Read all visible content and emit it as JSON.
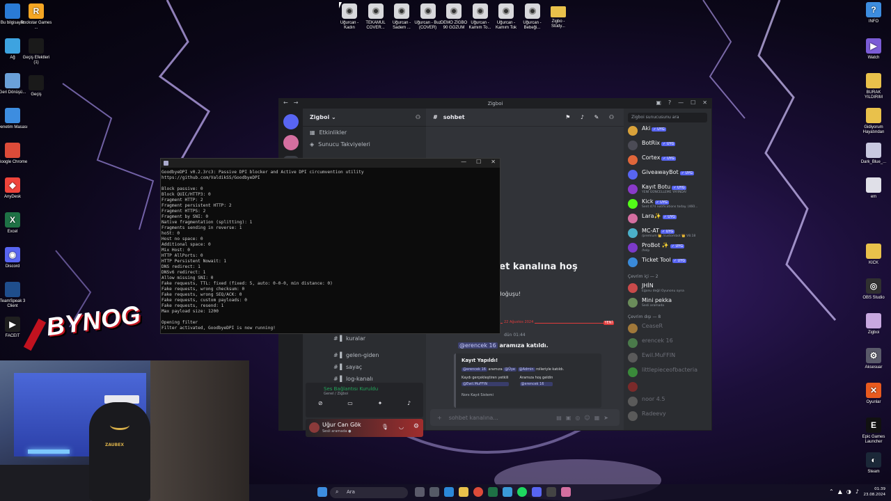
{
  "desktop_left": [
    {
      "label": "Bu bilgisayar",
      "color": "#2a7bd6",
      "glyph": ""
    },
    {
      "label": "Rockstar Games ...",
      "color": "#f5a623",
      "glyph": "R"
    },
    {
      "label": "Ağ",
      "color": "#3da3e0",
      "glyph": ""
    },
    {
      "label": "Geçiş Efektleri (1)",
      "color": "#1a1a1a",
      "glyph": ""
    },
    {
      "label": "Geri Dönüşü...",
      "color": "#6aa0d8",
      "glyph": ""
    },
    {
      "label": "Geçiş",
      "color": "#1a1a1a",
      "glyph": ""
    },
    {
      "label": "Denetim Masası",
      "color": "#3d8de0",
      "glyph": ""
    },
    {
      "label": "Google Chrome",
      "color": "#dd4b39",
      "glyph": ""
    },
    {
      "label": "AnyDesk",
      "color": "#ef443b",
      "glyph": "◆"
    },
    {
      "label": "Excel",
      "color": "#1e7145",
      "glyph": "X"
    },
    {
      "label": "Discord",
      "color": "#5865f2",
      "glyph": "◉"
    },
    {
      "label": "TeamSpeak 3 Client",
      "color": "#1f4e8c",
      "glyph": ""
    },
    {
      "label": "FACEIT",
      "color": "#1f1f1f",
      "glyph": "▶"
    }
  ],
  "desktop_top": [
    {
      "label": "Uğurcan - Kadın"
    },
    {
      "label": "TEKAMUL COVER..."
    },
    {
      "label": "Uğurcan - Sadem ..."
    },
    {
      "label": "Uğurcan - Buz (COVER)"
    },
    {
      "label": "DEMO ZİGBO 90 GOZUM"
    },
    {
      "label": "Uğurcan - Kamım To..."
    },
    {
      "label": "Uğurcan - Kamım Tok"
    },
    {
      "label": "Uğurcan - Bebeği..."
    },
    {
      "label": "Zigbo - Stüdy...",
      "folder": true
    }
  ],
  "desktop_right": [
    {
      "label": "INFO",
      "color": "#3d8de0",
      "glyph": "?"
    },
    {
      "label": "Watch",
      "color": "#7b5cd6",
      "glyph": "▶"
    },
    {
      "label": "BURAK YILDIRIM",
      "color": "#e9c14b",
      "glyph": ""
    },
    {
      "label": "Gidiyorum Hayatından",
      "color": "#e9c14b",
      "glyph": ""
    },
    {
      "label": "Dark_Blue_...",
      "color": "#c8c8e0",
      "glyph": ""
    },
    {
      "label": "em",
      "color": "#e0e0e8",
      "glyph": ""
    },
    {
      "label": "KICK",
      "color": "#e9c14b",
      "glyph": ""
    },
    {
      "label": "OBS Studio",
      "color": "#303030",
      "glyph": "◎"
    },
    {
      "label": "Zigboi",
      "color": "#c8a8e0",
      "glyph": ""
    },
    {
      "label": "Aksesuar",
      "color": "#5a5a6a",
      "glyph": "⚙"
    },
    {
      "label": "Oyunlar",
      "color": "#e85a1f",
      "glyph": "✕"
    },
    {
      "label": "Epic Games Launcher",
      "color": "#111111",
      "glyph": "E"
    },
    {
      "label": "Steam",
      "color": "#1b2838",
      "glyph": "◐"
    }
  ],
  "discord": {
    "window_title": "Zigboi",
    "server_name": "Zigboi",
    "rows": [
      "Etkinlikler",
      "Sunucu Takviyeleri"
    ],
    "channels": [
      "kuralar",
      "gelen-giden",
      "sayaç",
      "log-kanalı"
    ],
    "channel_header": "sohbet",
    "welcome": "bet kanalına hoş",
    "welcome_sub": "n doğuşu!",
    "divider_date": "22 Ağustos 2024",
    "divider_new": "YENİ",
    "msg_time": "dün 01:44",
    "msg_join_user": "@erencek 16",
    "msg_join_text": "aramıza katıldı.",
    "embed": {
      "title": "Kayıt Yapıldı!",
      "line1_user": "@erencek 16",
      "line1_mid": "aramıza",
      "line1_role1": "@Üye",
      "line1_role2": "@Admin",
      "line1_end": "rolleriyle katıldı.",
      "col1_label": "Kaydı gerçekleştiren yetkili",
      "col1_value": "@Ewil.MuFFIN",
      "col2_label": "Aramıza hoş geldin",
      "col2_value": "@erencek 16",
      "footer": "Norx Kayıt Sistemi"
    },
    "composer_placeholder": "sohbet kanalına...",
    "member_search": "Zigboi sunucusunu ara",
    "bots": [
      {
        "name": "Aki",
        "sub": "",
        "color": "#d9a23a"
      },
      {
        "name": "BotRix",
        "sub": "",
        "color": "#4b4b55"
      },
      {
        "name": "Cortex",
        "sub": "",
        "color": "#e0663a"
      },
      {
        "name": "GiveawayBot",
        "sub": "",
        "color": "#5865f2"
      },
      {
        "name": "Kayıt Botu",
        "sub": "YENİ GÜNCELLEME YAYINDA!",
        "color": "#8a3ac9"
      },
      {
        "name": "Kick",
        "sub": "Sent 474 notifications today. (460...",
        "color": "#53fc18"
      },
      {
        "name": "Lara✨",
        "sub": "",
        "color": "#d46fa0"
      },
      {
        "name": "MC-AT",
        "sub": "/premium 👑 /custombot 👑 V8.18",
        "color": "#4bb0c9"
      },
      {
        "name": "ProBot ✨",
        "sub": "/help",
        "color": "#7b3ac9"
      },
      {
        "name": "Ticket Tool",
        "sub": "",
        "color": "#3a8ad9"
      }
    ],
    "online_section": "Çevrim içi — 2",
    "online": [
      {
        "name": "JHİN",
        "sub": "Eğonu değil Oyunonu oyna",
        "color": "#c94a4a"
      },
      {
        "name": "Mini pekka",
        "sub": "Sesli aramada",
        "color": "#6a8c5a"
      }
    ],
    "offline_section": "Çevrim dışı — 8",
    "offline": [
      {
        "name": "CeaseR",
        "color": "#a0783a"
      },
      {
        "name": "erencek 16",
        "color": "#4a7a4a"
      },
      {
        "name": "Ewil.MuFFIN",
        "color": "#5a5a5a"
      },
      {
        "name": "littlepieceofbacteria",
        "color": "#3a8a3a"
      },
      {
        "name": "",
        "color": "#7a2a2a"
      },
      {
        "name": "noor 4.5",
        "color": "#5a5a5a"
      },
      {
        "name": "Radeevy",
        "color": "#5a5a5a"
      }
    ],
    "voice_status": "Ses Bağlantısı Kuruldu",
    "voice_sub": "Genel / Zigboi",
    "user_name": "Uğur Can Gök",
    "user_status": "Sesli aramada ●"
  },
  "console": {
    "lines": [
      "GoodbyeDPI v0.2.3rc3: Passive DPI blocker and Active DPI circumvention utility",
      "https://github.com/ValdikSS/GoodbyeDPI",
      "",
      "Block passive: 0",
      "Block QUIC/HTTP3: 0",
      "Fragment HTTP: 2",
      "Fragment persistent HTTP: 2",
      "Fragment HTTPS: 2",
      "Fragment by SNI: 0",
      "Native fragmentation (splitting): 1",
      "Fragments sending in reverse: 1",
      "hoSt: 0",
      "Host no space: 0",
      "Additional space: 0",
      "Mix Host: 0",
      "HTTP AllPorts: 0",
      "HTTP Persistent Nowait: 1",
      "DNS redirect: 1",
      "DNSv6 redirect: 1",
      "Allow missing SNI: 0",
      "Fake requests, TTL: fixed (fixed: 5, auto: 0-0-0, min distance: 0)",
      "Fake requests, wrong checksum: 0",
      "Fake requests, wrong SEQ/ACK: 0",
      "Fake requests, custom payloads: 0",
      "Fake requests, resend: 1",
      "Max payload size: 1200",
      "",
      "Opening filter",
      "Filter activated, GoodbyeDPI is now running!"
    ]
  },
  "brand_text": "BYNOG",
  "webcam_chair_text": "ZAUBEX",
  "taskbar": {
    "search_placeholder": "Ara",
    "time": "01:39",
    "date": "23.08.2024"
  }
}
